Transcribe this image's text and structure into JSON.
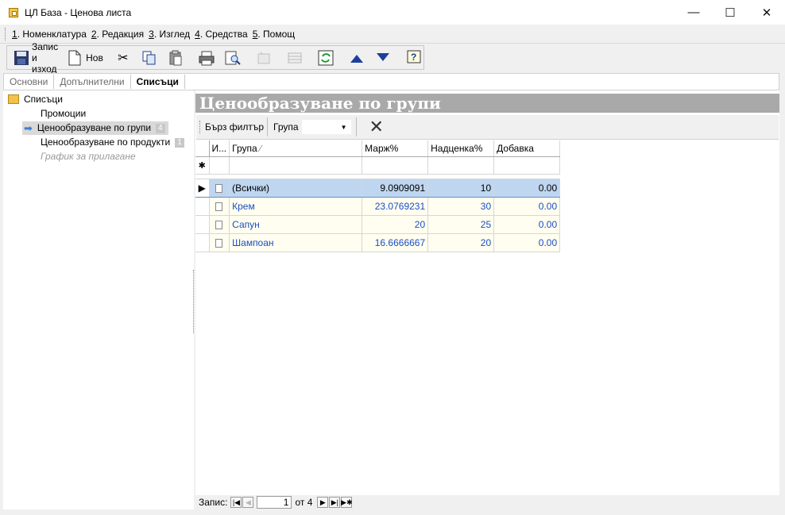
{
  "window": {
    "title": "ЦЛ База - Ценова листа",
    "minimize": "—",
    "maximize": "☐",
    "close": "✕"
  },
  "menu": [
    {
      "key": "1",
      "label": ". Номенклатура"
    },
    {
      "key": "2",
      "label": ". Редакция"
    },
    {
      "key": "3",
      "label": ". Изглед"
    },
    {
      "key": "4",
      "label": ". Средства"
    },
    {
      "key": "5",
      "label": ". Помощ"
    }
  ],
  "toolbar": {
    "save_exit": "Запис и изход",
    "new": "Нов"
  },
  "tabs": [
    "Основни",
    "Допълнителни",
    "Списъци"
  ],
  "tree": {
    "root": "Списъци",
    "items": [
      {
        "label": "Промоции"
      },
      {
        "label": "Ценообразуване по групи",
        "badge": "4"
      },
      {
        "label": "Ценообразуване по продукти",
        "badge": "1"
      },
      {
        "label": "График за прилагане"
      }
    ]
  },
  "panel": {
    "title": "Ценообразуване по групи"
  },
  "filter": {
    "quick": "Бърз филтър",
    "group": "Група"
  },
  "grid": {
    "headers": [
      "И...",
      "Група",
      "Марж%",
      "Надценка%",
      "Добавка"
    ],
    "sort_indicator": "∕",
    "new_row_marker": "✱",
    "rows": [
      {
        "group": "(Всички)",
        "margin": "9.0909091",
        "markup": "10",
        "addition": "0.00"
      },
      {
        "group": "Крем",
        "margin": "23.0769231",
        "markup": "30",
        "addition": "0.00"
      },
      {
        "group": "Сапун",
        "margin": "20",
        "markup": "25",
        "addition": "0.00"
      },
      {
        "group": "Шампоан",
        "margin": "16.6666667",
        "markup": "20",
        "addition": "0.00"
      }
    ]
  },
  "nav": {
    "label": "Запис:",
    "current": "1",
    "of": "от 4"
  }
}
